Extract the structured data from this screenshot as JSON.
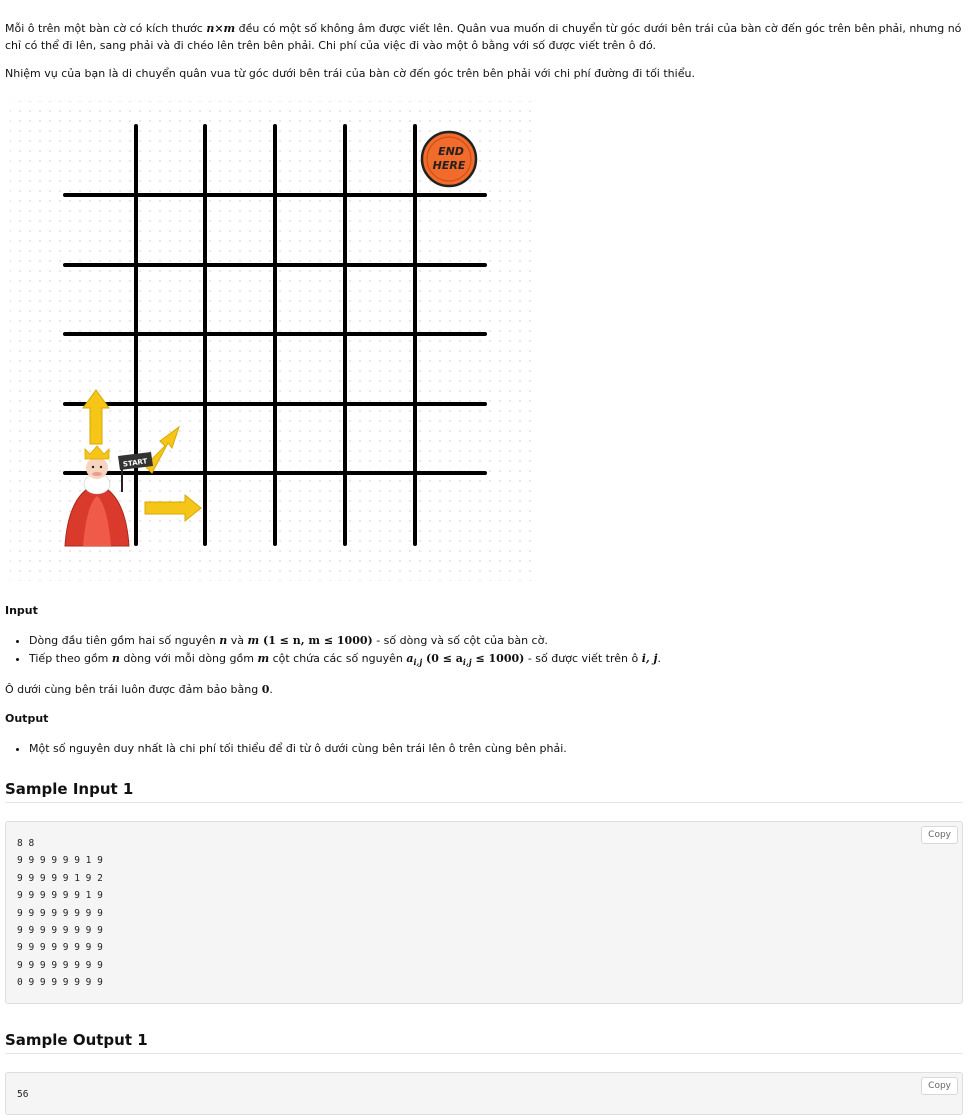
{
  "statement": {
    "p1_a": "Mỗi ô trên một bàn cờ có kích thước ",
    "p1_n": "n",
    "p1_x": "×",
    "p1_m": "m",
    "p1_b": " đều có một số không âm được viết lên. Quân vua muốn di chuyển từ góc dưới bên trái của bàn cờ đến góc trên bên phải, nhưng nó chỉ có thể đi lên, sang phải và đi chéo lên trên bên phải. Chi phí của việc đi vào một ô bằng với số được viết trên ô đó.",
    "p2": "Nhiệm vụ của bạn là di chuyển quân vua từ góc dưới bên trái của bàn cờ đến góc trên bên phải với chi phí đường đi tối thiểu."
  },
  "illustration": {
    "start_label": "START",
    "end_label_1": "END",
    "end_label_2": "HERE"
  },
  "input_section": {
    "heading": "Input",
    "item1_a": "Dòng đầu tiên gồm hai số nguyên ",
    "item1_n": "n",
    "item1_and": " và ",
    "item1_m": "m",
    "item1_constraint": " (1 ≤ n, m ≤ 1000)",
    "item1_b": " - số dòng và số cột của bàn cờ.",
    "item2_a": "Tiếp theo gồm ",
    "item2_n": "n",
    "item2_b": " dòng với mỗi dòng gồm ",
    "item2_m": "m",
    "item2_c": " cột chứa các số nguyên ",
    "item2_a_ij": "a",
    "item2_sub": "i,j",
    "item2_constraint": " (0 ≤ a",
    "item2_constraint_sub": "i,j",
    "item2_constraint_end": " ≤ 1000)",
    "item2_d": " - số được viết trên ô ",
    "item2_ij": "i, j",
    "item2_e": "."
  },
  "guarantee": {
    "text": "Ô dưới cùng bên trái luôn được đảm bảo bằng ",
    "zero": "0",
    "end": "."
  },
  "output_section": {
    "heading": "Output",
    "item1": "Một số nguyên duy nhất là chi phí tối thiểu để đi từ ô dưới cùng bên trái lên ô trên cùng bên phải."
  },
  "sample_input": {
    "heading": "Sample Input 1",
    "copy_label": "Copy",
    "content": "8 8\n9 9 9 9 9 9 1 9\n9 9 9 9 9 1 9 2\n9 9 9 9 9 9 1 9\n9 9 9 9 9 9 9 9\n9 9 9 9 9 9 9 9\n9 9 9 9 9 9 9 9\n9 9 9 9 9 9 9 9\n0 9 9 9 9 9 9 9"
  },
  "sample_output": {
    "heading": "Sample Output 1",
    "copy_label": "Copy",
    "content": "56"
  },
  "colors": {
    "arrow": "#f5c518",
    "end_badge": "#f26b2a",
    "king_robe": "#d93a2b",
    "crown": "#f5c518"
  }
}
